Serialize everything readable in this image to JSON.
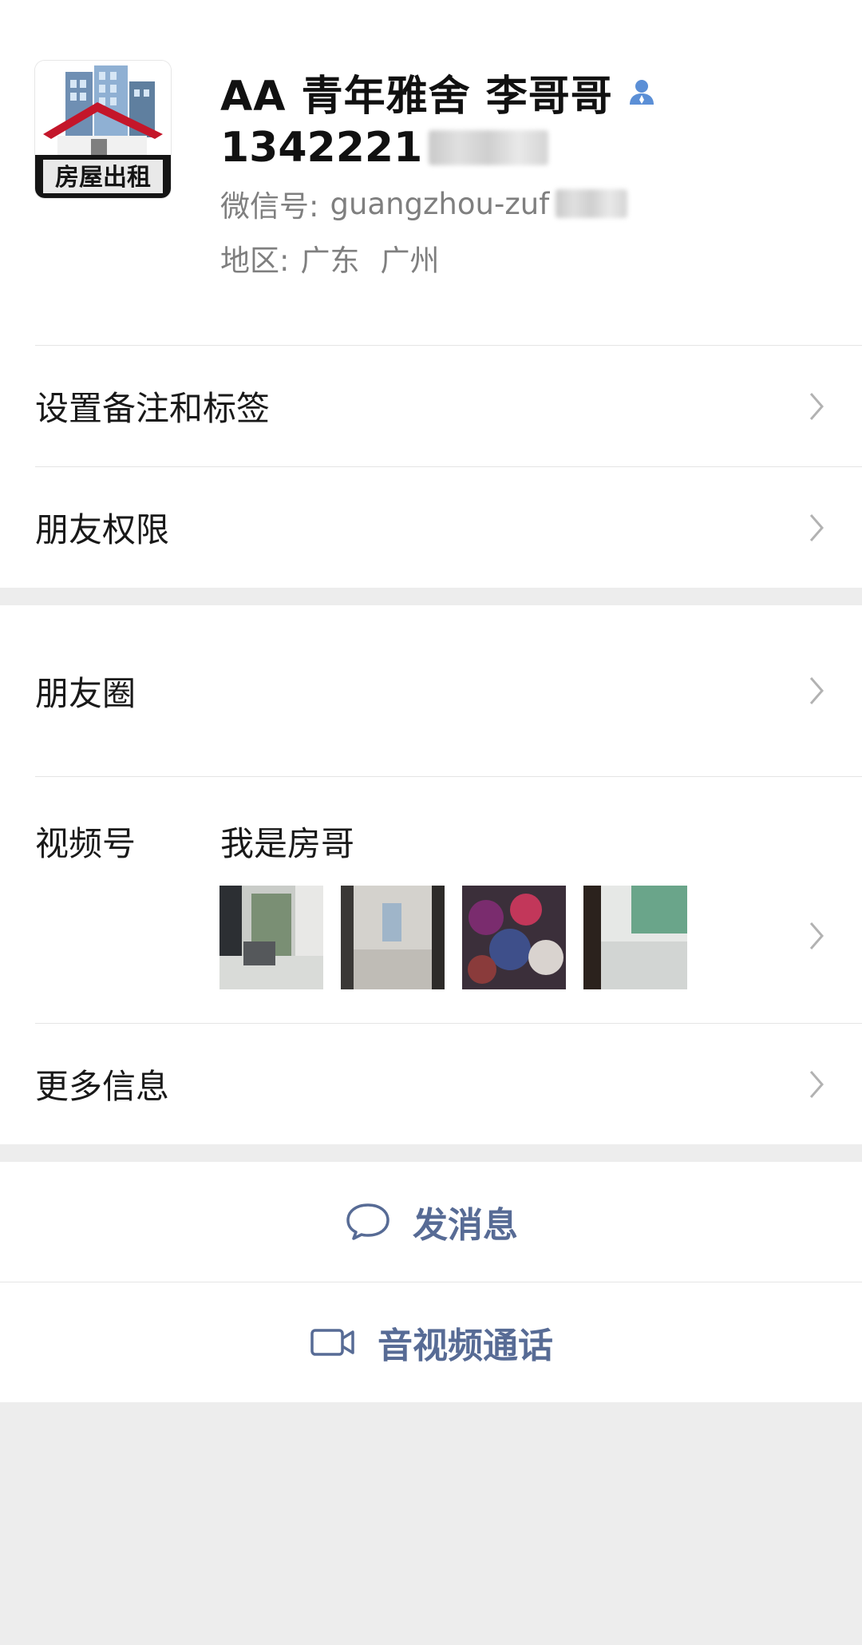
{
  "profile": {
    "name": "AA 青年雅舍 李哥哥",
    "phone_visible": "1342221",
    "wechat_id_label": "微信号:",
    "wechat_id_value": "guangzhou-zuf",
    "region_label": "地区:",
    "region_province": "广东",
    "region_city": "广州",
    "avatar_text": "房屋出租"
  },
  "menu": {
    "remarks_tags": "设置备注和标签",
    "friend_permissions": "朋友权限",
    "moments": "朋友圈",
    "channels": "视频号",
    "channels_name": "我是房哥",
    "more_info": "更多信息"
  },
  "actions": {
    "send_message": "发消息",
    "voice_video_call": "音视频通话"
  },
  "colors": {
    "link_blue": "#576b95",
    "verify_blue": "#5b8fd6",
    "background": "#ededed"
  },
  "icons": {
    "verify": "person-badge-icon",
    "chevron": "chevron-right-icon",
    "message": "chat-bubble-icon",
    "video": "video-camera-icon"
  }
}
